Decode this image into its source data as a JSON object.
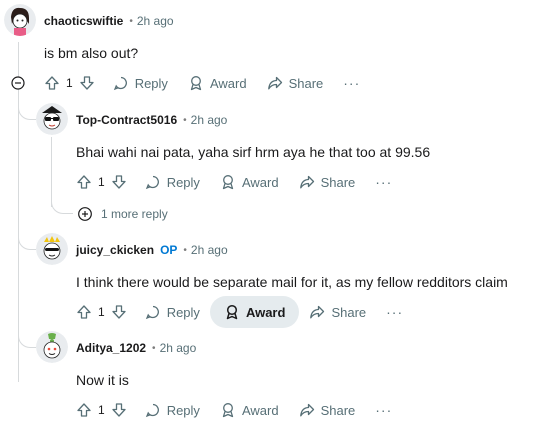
{
  "comments": [
    {
      "username": "chaoticswiftie",
      "op_badge": "",
      "time": "2h ago",
      "body": "is bm also out?",
      "votes": "1",
      "reply": "Reply",
      "award": "Award",
      "share": "Share",
      "more": "···"
    },
    {
      "username": "Top-Contract5016",
      "op_badge": "",
      "time": "2h ago",
      "body": "Bhai wahi nai pata, yaha sirf hrm aya he that too at 99.56",
      "votes": "1",
      "reply": "Reply",
      "award": "Award",
      "share": "Share",
      "more": "···",
      "more_replies": "1 more reply"
    },
    {
      "username": "juicy_ckicken",
      "op_badge": "OP",
      "time": "2h ago",
      "body": "I think there would be separate mail for it, as my fellow redditors claim",
      "votes": "1",
      "reply": "Reply",
      "award": "Award",
      "share": "Share",
      "more": "···"
    },
    {
      "username": "Aditya_1202",
      "op_badge": "",
      "time": "2h ago",
      "body": "Now it is",
      "votes": "1",
      "reply": "Reply",
      "award": "Award",
      "share": "Share",
      "more": "···"
    }
  ],
  "colors": {
    "text": "#1a1a1b",
    "meta": "#576f76",
    "op": "#0079d3",
    "thread_line": "#d7dadc",
    "active_button_bg": "#e5ebee"
  }
}
